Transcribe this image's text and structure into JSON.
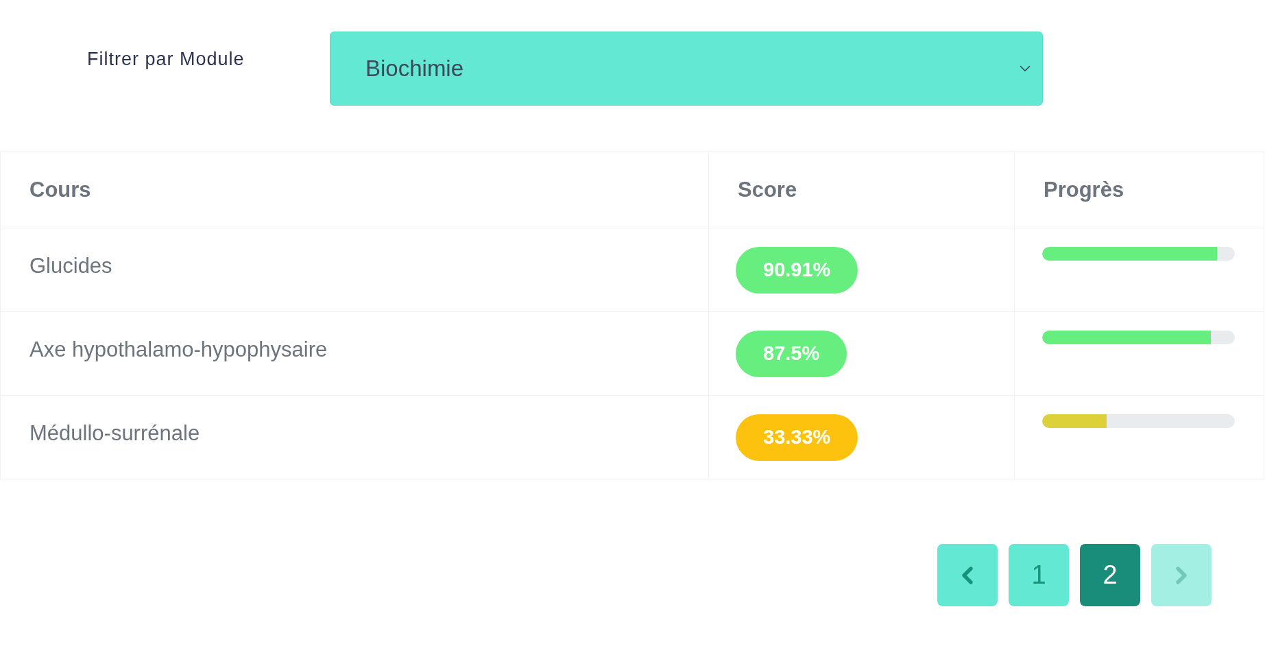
{
  "filter": {
    "label": "Filtrer par Module",
    "value": "Biochimie"
  },
  "table": {
    "columns": [
      "Cours",
      "Score",
      "Progrès"
    ],
    "rows": [
      {
        "course": "Glucides",
        "score": {
          "text": "90.91%",
          "color": "#66ee7f"
        },
        "progress": {
          "level": 0.9091,
          "color": "#66ee7f"
        }
      },
      {
        "course": "Axe hypothalamo-hypophysaire",
        "score": {
          "text": "87.5%",
          "color": "#66ee7f"
        },
        "progress": {
          "level": 0.875,
          "color": "#66ee7f"
        }
      },
      {
        "course": "Médullo-surrénale",
        "score": {
          "text": "33.33%",
          "color": "#fdc20e"
        },
        "progress": {
          "level": 0.3333,
          "color": "#ddd13a"
        }
      }
    ]
  },
  "pagination": {
    "previous": {
      "disabled": false
    },
    "pages": [
      {
        "label": "1",
        "selected": false
      },
      {
        "label": "2",
        "selected": true
      }
    ],
    "next": {
      "disabled": true
    }
  }
}
